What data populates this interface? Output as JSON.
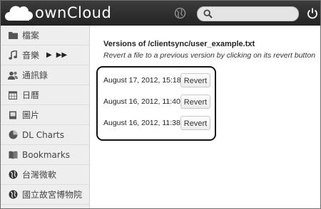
{
  "header": {
    "logo_text": "ownCloud",
    "search": {
      "value": "",
      "placeholder": ""
    },
    "colors": {
      "header_bg": "#2b2b2b",
      "logo": "#ffffff"
    },
    "icons": [
      "globe-icon",
      "search-icon",
      "power-icon"
    ]
  },
  "sidebar": {
    "items": [
      {
        "label": "檔案",
        "icon": "folder-icon"
      },
      {
        "label": "音樂",
        "icon": "music-icon",
        "player": {
          "play": "▶",
          "next": "▶▶"
        }
      },
      {
        "label": "通訊錄",
        "icon": "contacts-icon"
      },
      {
        "label": "日曆",
        "icon": "calendar-icon"
      },
      {
        "label": "圖片",
        "icon": "pictures-icon"
      },
      {
        "label": "DL Charts",
        "icon": "pie-chart-icon"
      },
      {
        "label": "Bookmarks",
        "icon": "bookmark-icon"
      },
      {
        "label": "台灣微軟",
        "icon": "globe-link-icon"
      },
      {
        "label": "國立故宮博物院",
        "icon": "globe-link-icon"
      }
    ]
  },
  "main": {
    "title": "Versions of /clientsync/user_example.txt",
    "hint": "Revert a file to a previous version by clicking on its revert button",
    "versions": [
      {
        "date": "August 17, 2012, 15:18",
        "revert_label": "Revert"
      },
      {
        "date": "August 16, 2012, 11:40",
        "revert_label": "Revert"
      },
      {
        "date": "August 16, 2012, 11:38",
        "revert_label": "Revert"
      }
    ]
  }
}
